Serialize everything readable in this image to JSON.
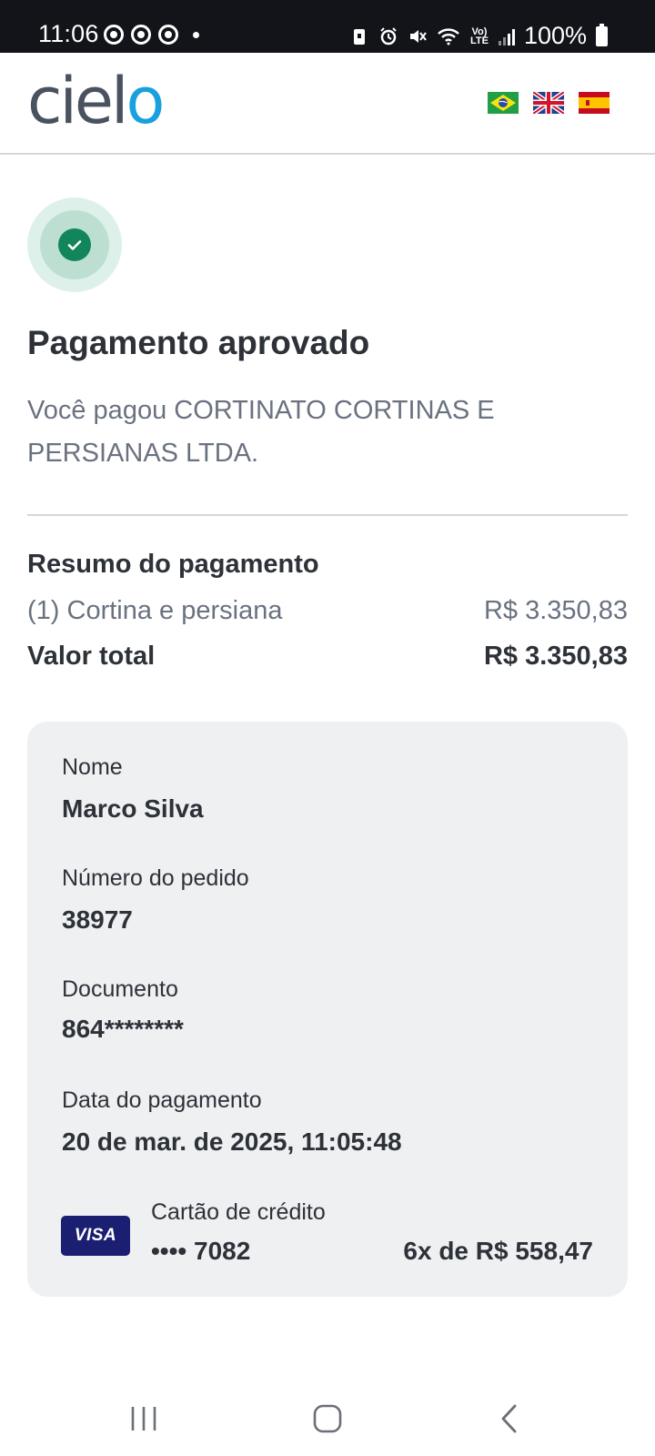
{
  "status_bar": {
    "time": "11:06",
    "battery": "100%",
    "volte_top": "Vo)",
    "volte_bottom": "LTE"
  },
  "header": {
    "logo_left": "ciel",
    "logo_right": "o",
    "languages": [
      "pt-BR",
      "en-GB",
      "es"
    ]
  },
  "colors": {
    "brand_blue": "#1aa0dc",
    "success_green": "#13855b",
    "text_dark": "#2d3138",
    "text_muted": "#6a7280",
    "card_bg": "#eff0f2",
    "visa_blue": "#1a1f71"
  },
  "main": {
    "title": "Pagamento aprovado",
    "message": "Você pagou CORTINATO CORTINAS E PERSIANAS LTDA."
  },
  "summary": {
    "title": "Resumo do pagamento",
    "item_label": "(1) Cortina e persiana",
    "item_value": "R$ 3.350,83",
    "total_label": "Valor total",
    "total_value": "R$ 3.350,83"
  },
  "details": {
    "name_label": "Nome",
    "name_value": "Marco Silva",
    "order_label": "Número do pedido",
    "order_value": "38977",
    "document_label": "Documento",
    "document_value": "864********",
    "date_label": "Data do pagamento",
    "date_value": "20 de mar. de 2025, 11:05:48",
    "card_brand": "VISA",
    "card_type": "Cartão de crédito",
    "card_number": "•••• 7082",
    "installments": "6x de R$ 558,47"
  }
}
